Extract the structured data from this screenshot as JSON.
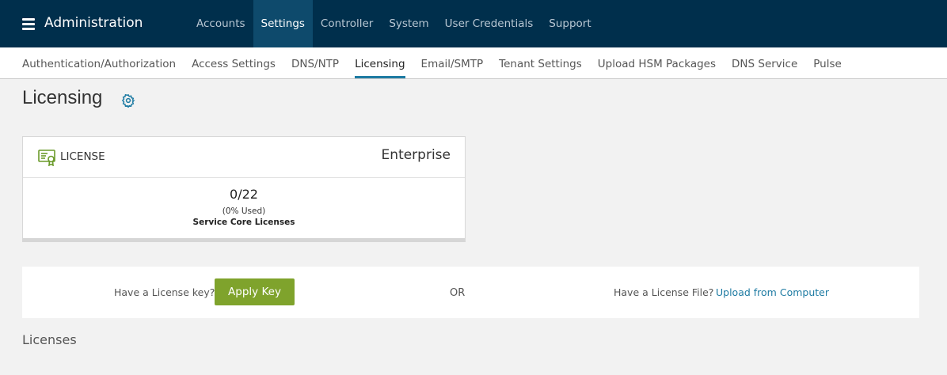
{
  "header": {
    "app_title": "Administration",
    "nav": [
      {
        "label": "Accounts",
        "active": false
      },
      {
        "label": "Settings",
        "active": true
      },
      {
        "label": "Controller",
        "active": false
      },
      {
        "label": "System",
        "active": false
      },
      {
        "label": "User Credentials",
        "active": false
      },
      {
        "label": "Support",
        "active": false
      }
    ]
  },
  "subnav": {
    "tabs": [
      {
        "label": "Authentication/Authorization",
        "active": false
      },
      {
        "label": "Access Settings",
        "active": false
      },
      {
        "label": "DNS/NTP",
        "active": false
      },
      {
        "label": "Licensing",
        "active": true
      },
      {
        "label": "Email/SMTP",
        "active": false
      },
      {
        "label": "Tenant Settings",
        "active": false
      },
      {
        "label": "Upload HSM Packages",
        "active": false
      },
      {
        "label": "DNS Service",
        "active": false
      },
      {
        "label": "Pulse",
        "active": false
      }
    ]
  },
  "page": {
    "title": "Licensing",
    "settings_icon": "gear-icon"
  },
  "license_card": {
    "icon": "license-certificate-icon",
    "label": "LICENSE",
    "edition": "Enterprise",
    "usage_value": "0/22",
    "usage_percent": "(0% Used)",
    "usage_label": "Service Core Licenses"
  },
  "license_actions": {
    "key_prompt": "Have a License key?",
    "apply_button": "Apply Key",
    "or_text": "OR",
    "file_prompt": "Have a License File?",
    "upload_link": "Upload from Computer"
  },
  "licenses_section": {
    "title": "Licenses"
  },
  "colors": {
    "header_bg": "#002f4c",
    "active_nav_bg": "#0e4a6c",
    "accent_blue": "#1e7ba3",
    "button_green": "#7fa32c"
  }
}
